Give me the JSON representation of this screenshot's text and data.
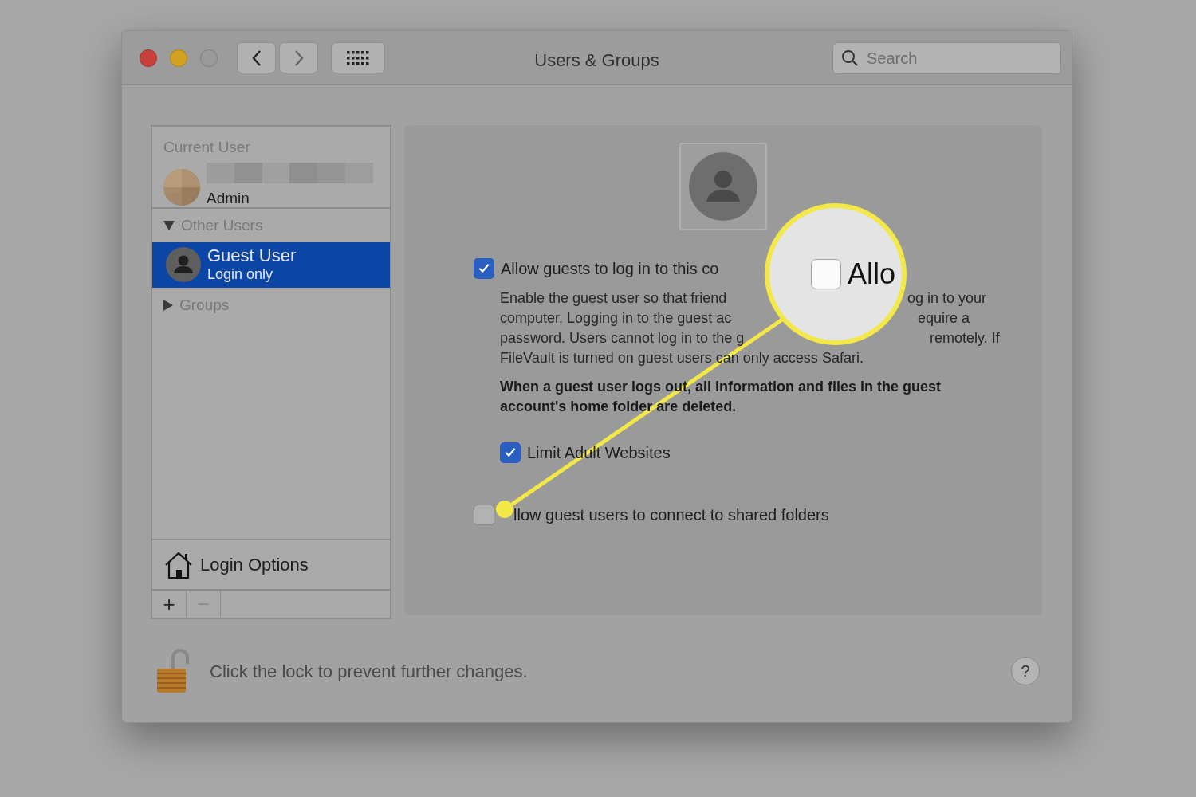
{
  "window": {
    "title": "Users & Groups"
  },
  "search": {
    "placeholder": "Search"
  },
  "sidebar": {
    "current_user": {
      "header": "Current User",
      "role": "Admin"
    },
    "sections": [
      {
        "label": "Other Users",
        "expanded": true,
        "items": [
          {
            "name": "Guest User",
            "subtitle": "Login only",
            "selected": true
          }
        ]
      },
      {
        "label": "Groups",
        "expanded": false
      }
    ],
    "login_options": "Login Options",
    "add_button": {
      "label": "+",
      "disabled": false
    },
    "remove_button": {
      "label": "−",
      "disabled": true
    }
  },
  "guest_options": {
    "allow_login": {
      "label": "Allow guests to log in to this co",
      "checked": true
    },
    "description_lines": [
      {
        "left": "Enable the guest user so that friend",
        "right": "og in to your"
      },
      {
        "left": "computer. Logging in to the guest ac",
        "right": "equire a"
      },
      {
        "left": "password. Users cannot log in to the g",
        "right": "remotely. If"
      },
      {
        "left": "FileVault is turned on guest users can only access Safari."
      }
    ],
    "warning": "When a guest user logs out, all information and files in the guest account's home folder are deleted.",
    "limit_adult": {
      "label": "Limit Adult Websites",
      "checked": true
    },
    "shared_folders": {
      "label": "llow guest users to connect to shared folders",
      "checked": false
    }
  },
  "callout": {
    "label": "Allo",
    "checked": false
  },
  "footer": {
    "lock_text": "Click the lock to prevent further changes.",
    "help": "?"
  }
}
